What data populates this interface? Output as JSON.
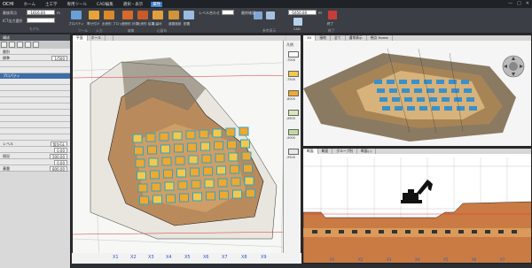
{
  "app": {
    "name": "OCHI",
    "window_controls": [
      "—",
      "□",
      "✕"
    ]
  },
  "menu": [
    "ホーム",
    "土工学",
    "専用ツール",
    "CAD編集",
    "選択・表示",
    "属性"
  ],
  "ribbon": {
    "label1": "最後寄点",
    "value1": "-1616.00",
    "unit1": "m",
    "label2": "ICT出力選択",
    "label3": "レベル合わせ",
    "label4": "最終確認",
    "value4": "-1650.00",
    "unit4": "m",
    "buttons": [
      "プロパティ",
      "寄せ付け",
      "出来形\nブロック",
      "出来形\n計算",
      "出来形\n結果",
      "山留め",
      "道路施設",
      "",
      "配置",
      "",
      "",
      "CAD",
      "",
      "",
      "プロパティ",
      "",
      "",
      "終了"
    ],
    "groups": [
      "モデル",
      "ツール",
      "入力",
      "編集",
      "山留め",
      "",
      "",
      "参考表示",
      "",
      "終了"
    ]
  },
  "left": {
    "head": "構成",
    "tools": [
      "",
      "",
      "",
      "",
      ""
    ],
    "rows": [
      {
        "k": "層別",
        "v": ""
      },
      {
        "k": "標準",
        "v": "1/500"
      },
      {
        "k": "",
        "v": ""
      },
      {
        "k": "",
        "v": ""
      }
    ],
    "section": "プロパティ",
    "props": [
      {
        "k": "",
        "v": ""
      },
      {
        "k": "",
        "v": ""
      },
      {
        "k": "",
        "v": ""
      },
      {
        "k": "",
        "v": ""
      },
      {
        "k": "",
        "v": ""
      },
      {
        "k": "",
        "v": ""
      },
      {
        "k": "",
        "v": ""
      },
      {
        "k": "",
        "v": ""
      },
      {
        "k": "",
        "v": ""
      },
      {
        "k": "",
        "v": ""
      },
      {
        "k": "レベル",
        "v": "設計GL"
      },
      {
        "k": "",
        "v": "0.00"
      },
      {
        "k": "現況",
        "v": "500.00"
      },
      {
        "k": "",
        "v": "0.00"
      },
      {
        "k": "基盤",
        "v": "800.00"
      }
    ]
  },
  "plan": {
    "tabs": [
      "平面",
      "ホール",
      "",
      "",
      "",
      "パース"
    ],
    "legend_title": "凡例",
    "legend_values": [
      "-7000",
      "-7500",
      "-8000",
      "-8500",
      "-9000",
      "-9500"
    ],
    "legend_colors": [
      "#ffffff",
      "#f2c94c",
      "#f0a830",
      "#d7e8b8",
      "#c0d9a0",
      "#e8e8e8"
    ],
    "xaxis": [
      "X1",
      "X2",
      "X3",
      "X4",
      "X5",
      "X6",
      "X7",
      "X8",
      "X9"
    ]
  },
  "persp": {
    "tabs": [
      "3D",
      "3D",
      "接地",
      "全て",
      "通常表示",
      "視点 Home"
    ]
  },
  "section": {
    "tabs": [
      "断面",
      "",
      "断面",
      "グループ別",
      "断面(-)"
    ],
    "xaxis": [
      "X1",
      "X2",
      "X3",
      "X4",
      "X5",
      "X6",
      "X7",
      "X8",
      "X9"
    ]
  }
}
